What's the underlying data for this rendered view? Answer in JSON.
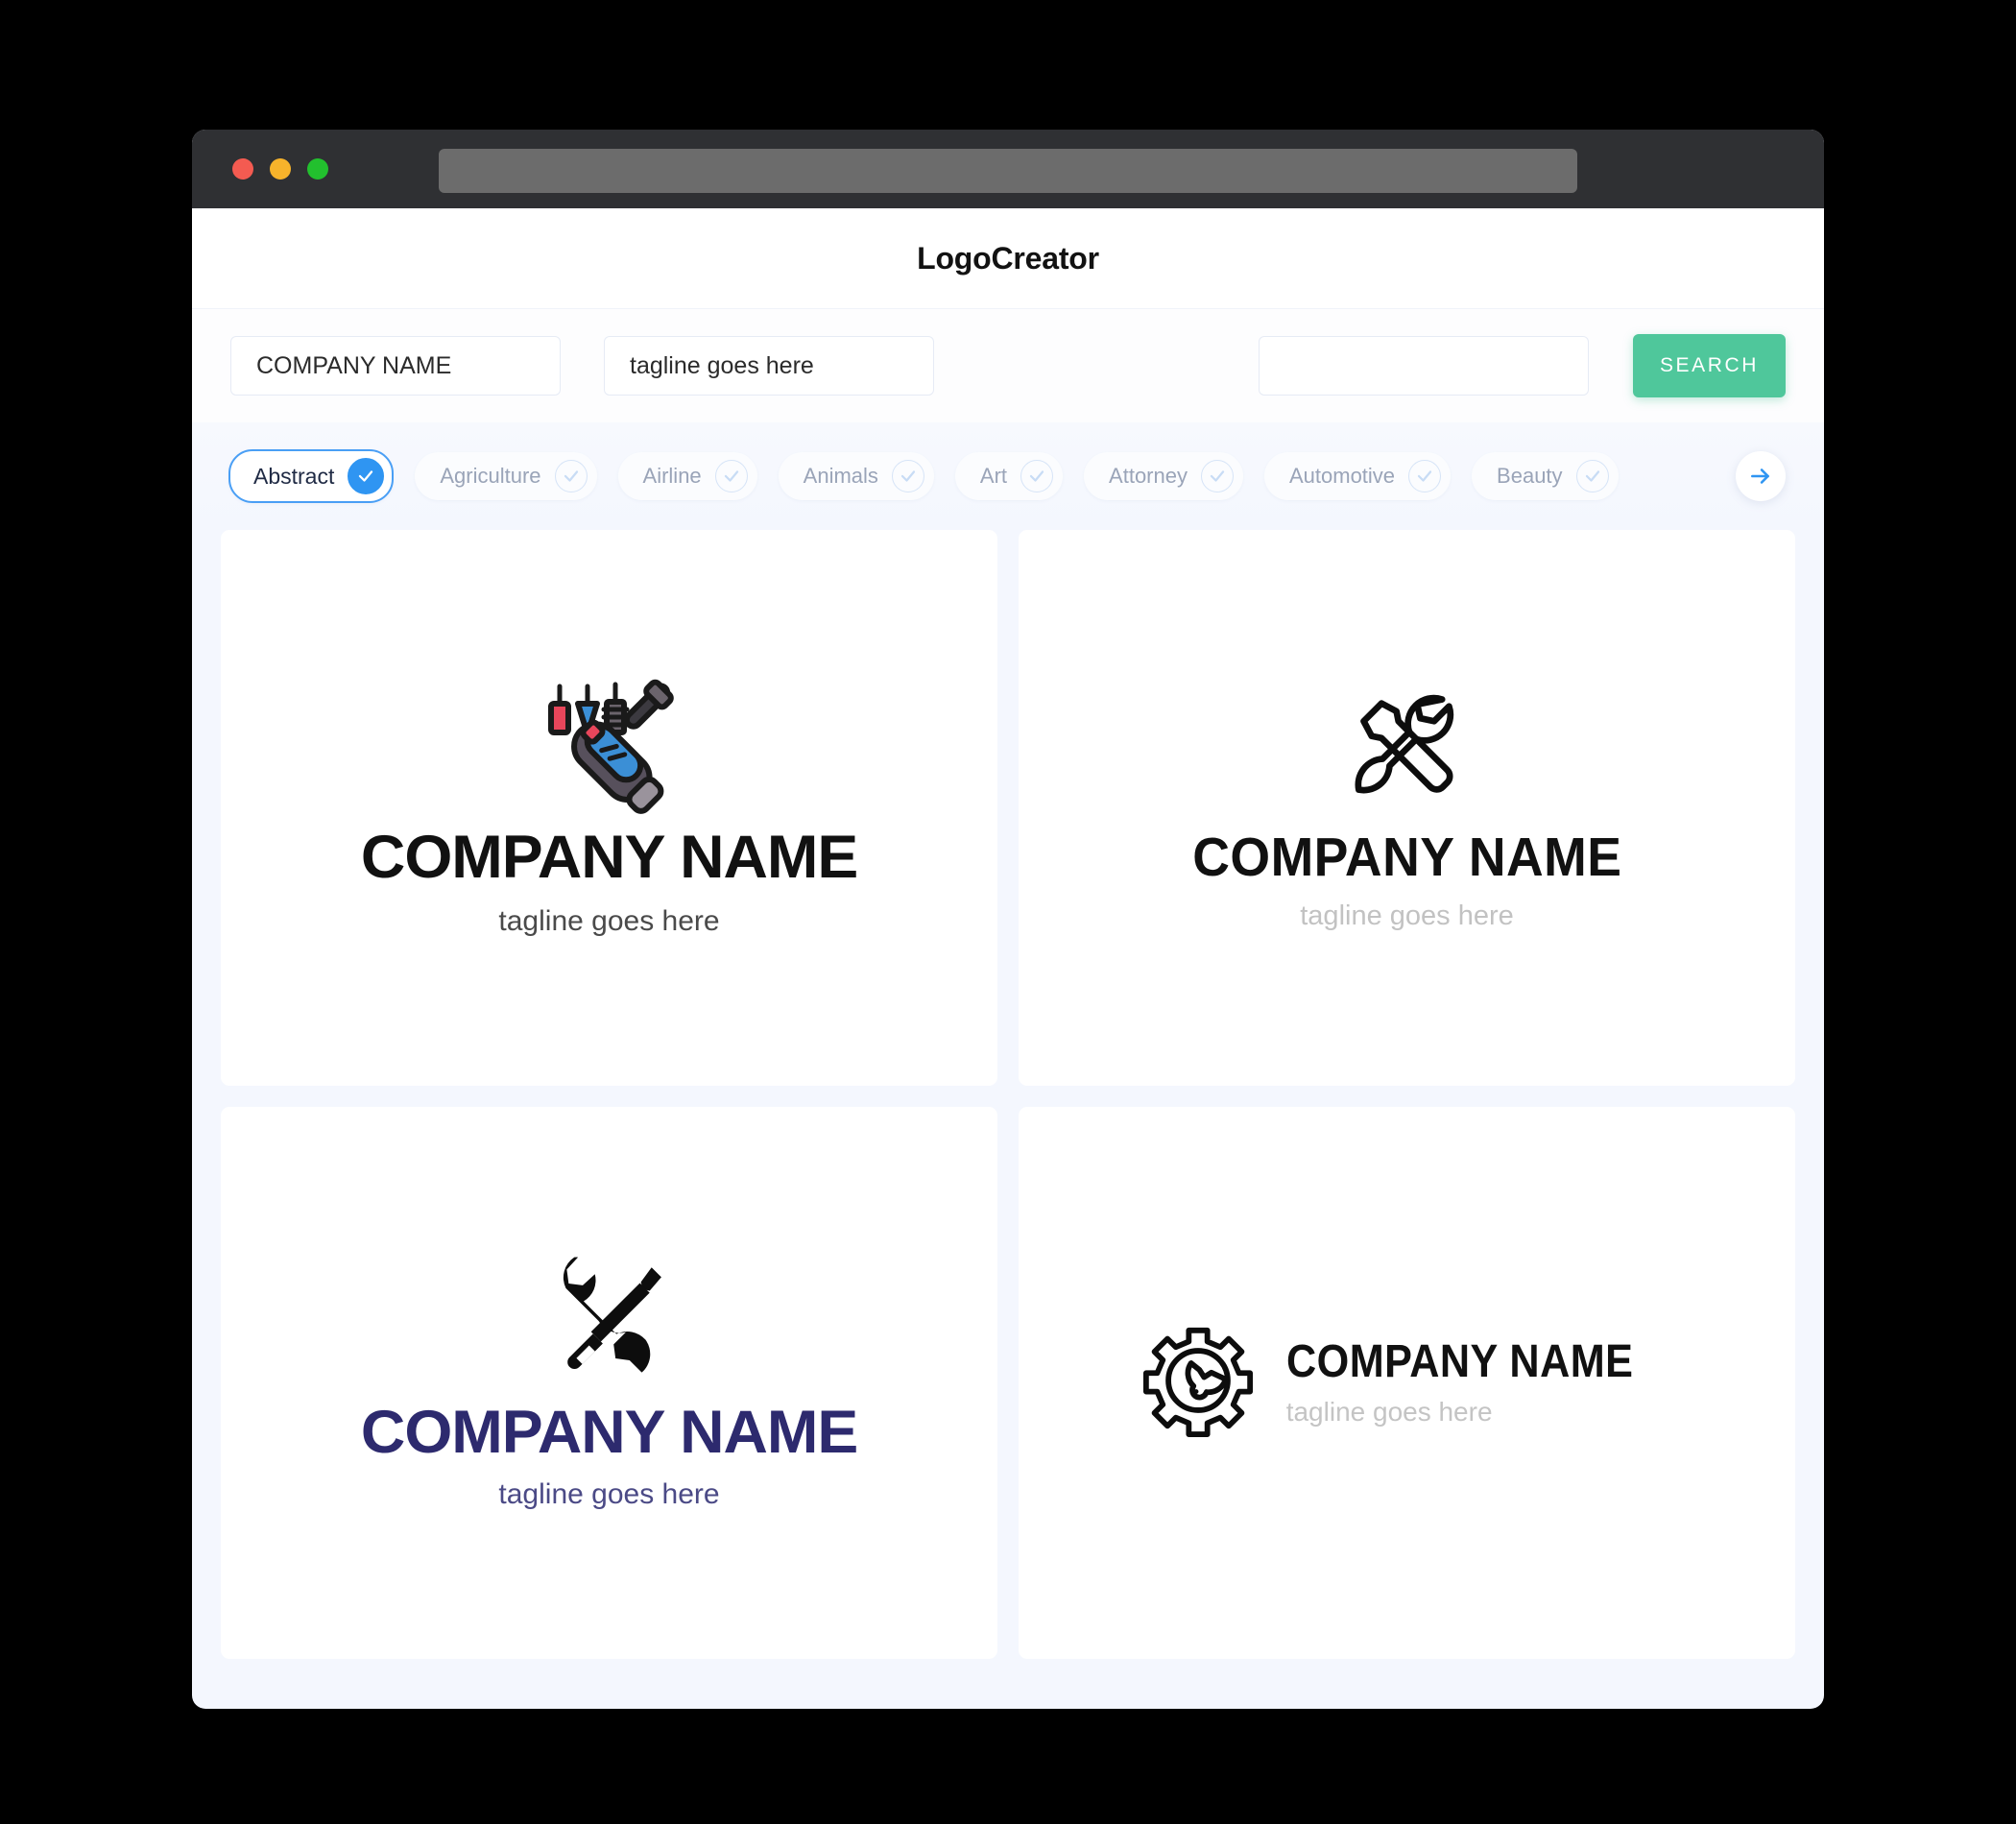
{
  "window": {
    "traffic_lights": [
      {
        "name": "close",
        "color": "#F45B51"
      },
      {
        "name": "minimize",
        "color": "#F7B32B"
      },
      {
        "name": "maximize",
        "color": "#22C02E"
      }
    ],
    "address_value": ""
  },
  "header": {
    "title": "LogoCreator"
  },
  "search": {
    "company_value": "COMPANY NAME",
    "company_placeholder": "COMPANY NAME",
    "tagline_value": "tagline goes here",
    "tagline_placeholder": "tagline goes here",
    "third_value": "",
    "third_placeholder": "",
    "button_label": "SEARCH",
    "button_color": "#4FC79B"
  },
  "categories": {
    "selected": "Abstract",
    "accent_color": "#2F95F2",
    "next_arrow_icon": "arrow-right-icon",
    "items": [
      {
        "label": "Abstract",
        "selected": true
      },
      {
        "label": "Agriculture",
        "selected": false
      },
      {
        "label": "Airline",
        "selected": false
      },
      {
        "label": "Animals",
        "selected": false
      },
      {
        "label": "Art",
        "selected": false
      },
      {
        "label": "Attorney",
        "selected": false
      },
      {
        "label": "Automotive",
        "selected": false
      },
      {
        "label": "Beauty",
        "selected": false
      }
    ]
  },
  "results": [
    {
      "id": "logo-1",
      "icon": "rotary-screwdriver-icon",
      "layout": "stack",
      "company_name": "COMPANY NAME",
      "tagline": "tagline goes here",
      "name_color": "#111111",
      "tagline_color": "#4A4A4A"
    },
    {
      "id": "logo-2",
      "icon": "wrench-screwdriver-outline-icon",
      "layout": "stack",
      "company_name": "COMPANY NAME",
      "tagline": "tagline goes here",
      "name_color": "#111111",
      "tagline_color": "#C2C2C2"
    },
    {
      "id": "logo-3",
      "icon": "wrench-screwdriver-solid-icon",
      "layout": "stack",
      "company_name": "COMPANY NAME",
      "tagline": "tagline goes here",
      "name_color": "#2D2A6E",
      "tagline_color": "#4B4A86"
    },
    {
      "id": "logo-4",
      "icon": "gear-wrench-outline-icon",
      "layout": "row",
      "company_name": "COMPANY NAME",
      "tagline": "tagline goes here",
      "name_color": "#111111",
      "tagline_color": "#C4C4C4"
    }
  ]
}
